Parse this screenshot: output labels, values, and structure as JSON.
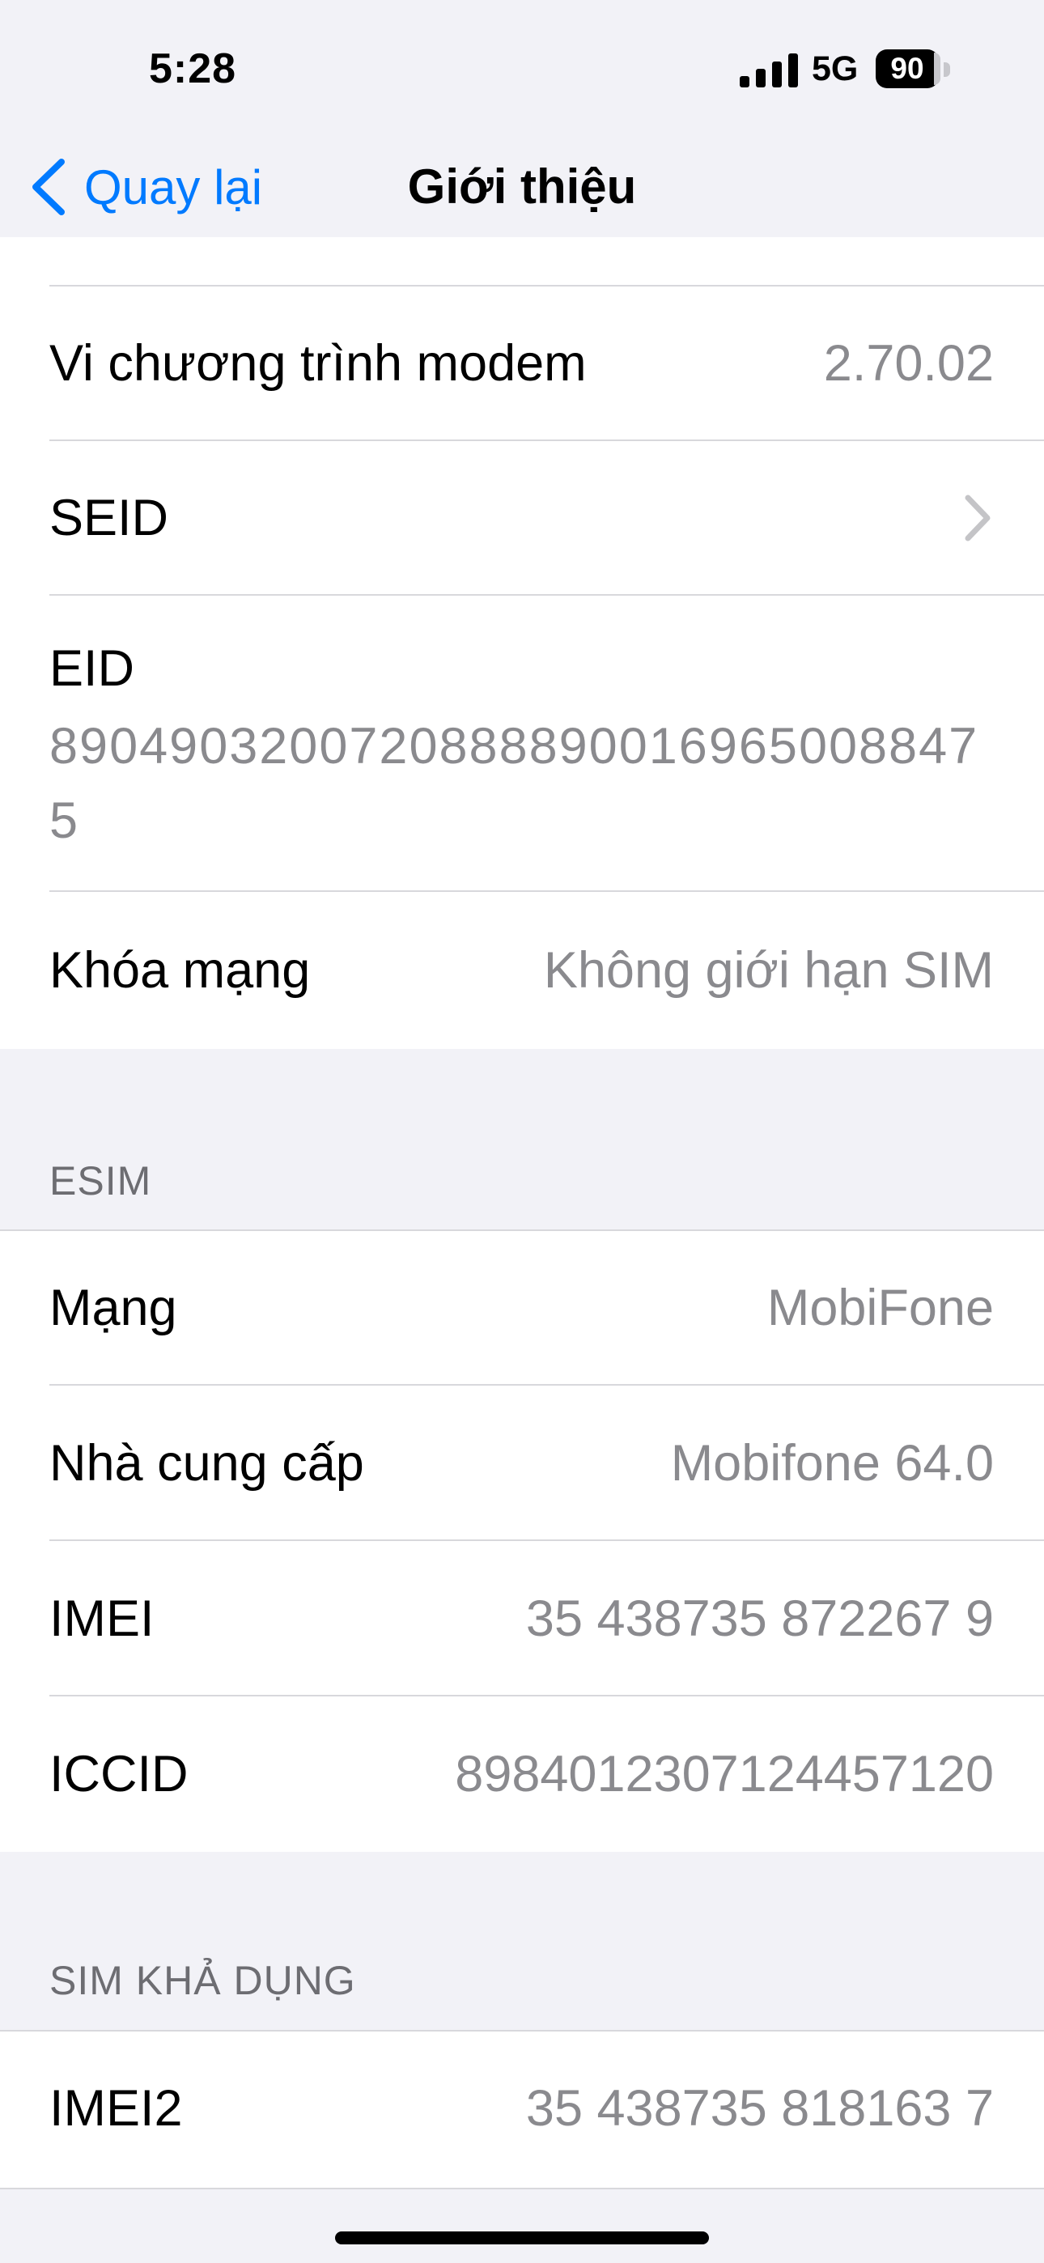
{
  "status_bar": {
    "time": "5:28",
    "network": "5G",
    "battery": "90"
  },
  "nav": {
    "back_label": "Quay lại",
    "title": "Giới thiệu"
  },
  "group1": {
    "rows": [
      {
        "label": "Vi chương trình modem",
        "value": "2.70.02"
      },
      {
        "label": "SEID",
        "value": ""
      }
    ],
    "eid": {
      "label": "EID",
      "value": "89049032007208888900169650088475"
    },
    "lock": {
      "label": "Khóa mạng",
      "value": "Không giới hạn SIM"
    }
  },
  "esim": {
    "header": "ESIM",
    "rows": [
      {
        "label": "Mạng",
        "value": "MobiFone"
      },
      {
        "label": "Nhà cung cấp",
        "value": "Mobifone 64.0"
      },
      {
        "label": "IMEI",
        "value": "35 438735 872267 9"
      },
      {
        "label": "ICCID",
        "value": "8984012307124457120"
      }
    ]
  },
  "available_sim": {
    "header": "SIM KHẢ DỤNG",
    "rows": [
      {
        "label": "IMEI2",
        "value": "35 438735 818163 7"
      }
    ]
  }
}
